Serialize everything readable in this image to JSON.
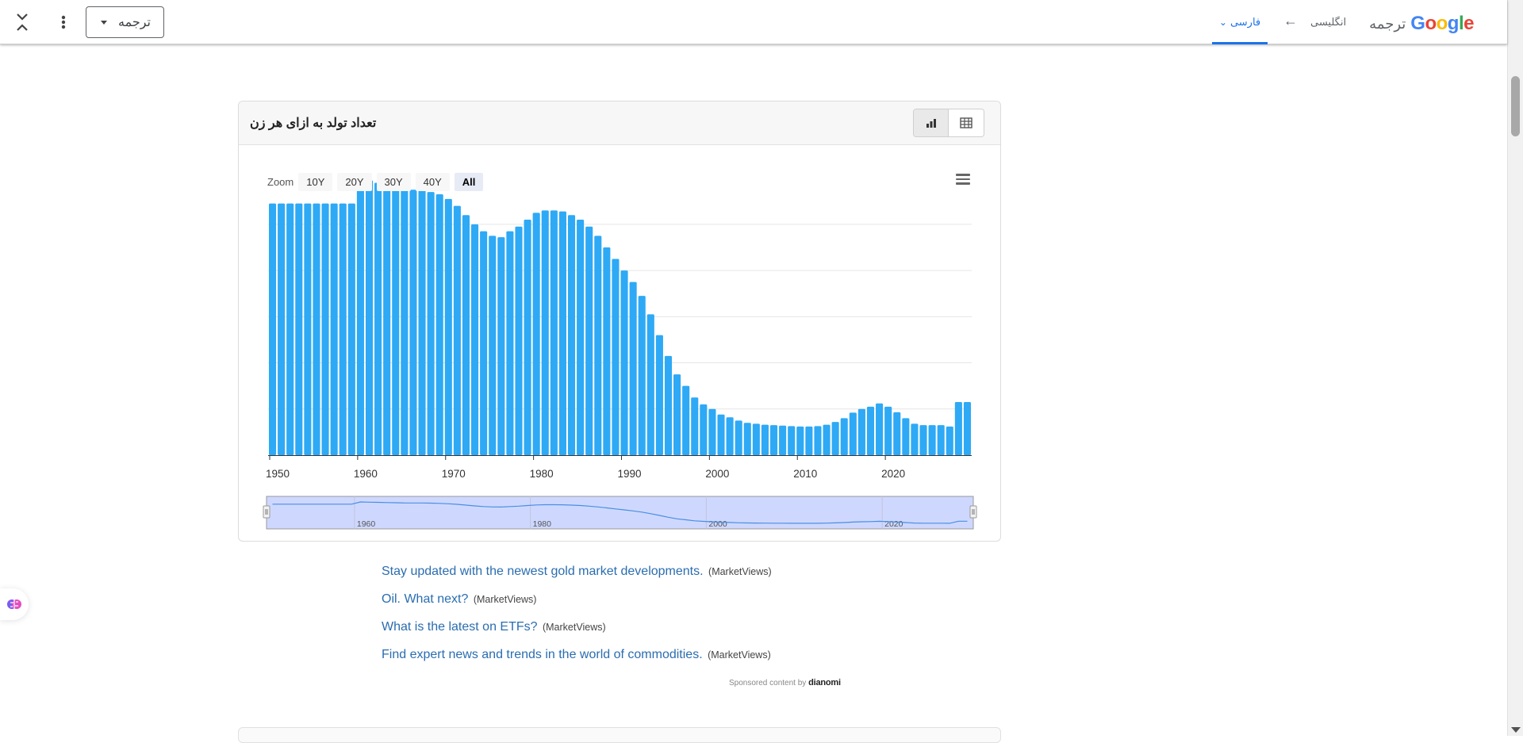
{
  "translate_bar": {
    "dropdown_label": "ترجمه",
    "logo_text": "Google",
    "title": "ترجمه",
    "source_lang": "انگلیسی",
    "arrow": "←",
    "target_lang": "فارسی"
  },
  "card": {
    "title": "تعداد تولد به ازای هر زن",
    "zoom": {
      "label": "Zoom",
      "buttons": [
        "10Y",
        "20Y",
        "30Y",
        "40Y",
        "All"
      ],
      "active": "All"
    }
  },
  "chart_data": {
    "type": "bar",
    "title": "تعداد تولد به ازای هر زن",
    "x_start": 1950,
    "x_end": 2025,
    "x_ticks": [
      "1950",
      "1960",
      "1970",
      "1980",
      "1990",
      "2000",
      "2010",
      "2020"
    ],
    "values": [
      5.45,
      5.45,
      5.45,
      5.45,
      5.45,
      5.45,
      5.45,
      5.45,
      5.45,
      5.45,
      6.0,
      5.95,
      5.9,
      5.85,
      5.8,
      5.75,
      5.75,
      5.75,
      5.7,
      5.65,
      5.55,
      5.4,
      5.2,
      5.0,
      4.85,
      4.75,
      4.72,
      4.85,
      4.95,
      5.1,
      5.25,
      5.3,
      5.3,
      5.28,
      5.2,
      5.1,
      4.95,
      4.75,
      4.5,
      4.25,
      4.0,
      3.75,
      3.45,
      3.05,
      2.6,
      2.15,
      1.75,
      1.5,
      1.25,
      1.1,
      1.0,
      0.88,
      0.82,
      0.75,
      0.7,
      0.68,
      0.66,
      0.65,
      0.64,
      0.63,
      0.62,
      0.62,
      0.63,
      0.66,
      0.72,
      0.8,
      0.92,
      1.0,
      1.05,
      1.12,
      1.05,
      0.93,
      0.8,
      0.68,
      0.65,
      0.65,
      0.65,
      0.62,
      1.15,
      1.15
    ],
    "ylim": [
      0,
      6.2
    ],
    "grid": true,
    "bar_color": "#2ea9f5",
    "navigator_ticks": [
      "1960",
      "1980",
      "2000",
      "2020"
    ]
  },
  "sponsored": {
    "links": [
      {
        "text": "Stay updated with the newest gold market developments.",
        "source": "(MarketViews)"
      },
      {
        "text": "Oil. What next?",
        "source": "(MarketViews)"
      },
      {
        "text": "What is the latest on ETFs?",
        "source": "(MarketViews)"
      },
      {
        "text": "Find expert news and trends in the world of commodities.",
        "source": "(MarketViews)"
      }
    ],
    "footer_prefix": "Sponsored content by",
    "footer_brand": "dianomi"
  }
}
